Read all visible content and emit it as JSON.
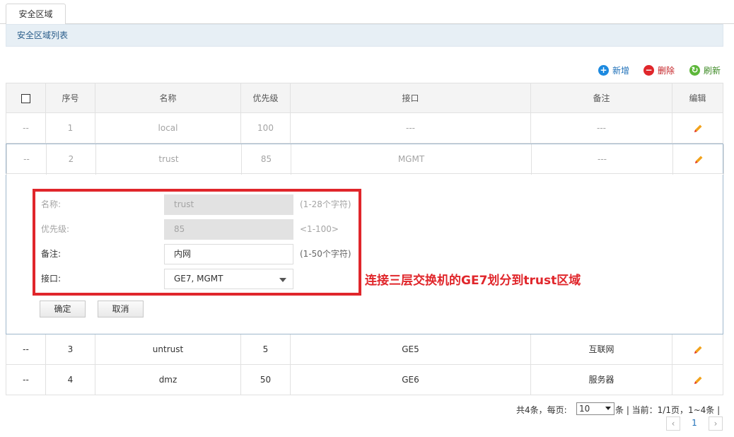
{
  "tab": {
    "label": "安全区域"
  },
  "section": {
    "title": "安全区域列表"
  },
  "toolbar": {
    "add_label": "新增",
    "delete_label": "删除",
    "refresh_label": "刷新"
  },
  "colors": {
    "add": "#1d8ae0",
    "delete": "#e0262b",
    "refresh": "#5db73a",
    "annotation": "#e0262b"
  },
  "table": {
    "headers": [
      "序号",
      "名称",
      "优先级",
      "接口",
      "备注",
      "编辑"
    ],
    "rows": [
      {
        "sel": "--",
        "index": "1",
        "name": "local",
        "priority": "100",
        "iface": "---",
        "note": "---"
      },
      {
        "sel": "--",
        "index": "2",
        "name": "trust",
        "priority": "85",
        "iface": "MGMT",
        "note": "---"
      },
      {
        "sel": "--",
        "index": "3",
        "name": "untrust",
        "priority": "5",
        "iface": "GE5",
        "note": "互联网"
      },
      {
        "sel": "--",
        "index": "4",
        "name": "dmz",
        "priority": "50",
        "iface": "GE6",
        "note": "服务器"
      }
    ]
  },
  "form": {
    "name_label": "名称:",
    "name_value": "trust",
    "name_hint": "(1-28个字符)",
    "priority_label": "优先级:",
    "priority_value": "85",
    "priority_hint": "<1-100>",
    "note_label": "备注:",
    "note_value": "内网",
    "note_hint": "(1-50个字符)",
    "iface_label": "接口:",
    "iface_value": "GE7, MGMT",
    "ok_label": "确定",
    "cancel_label": "取消"
  },
  "annotation": "连接三层交换机的GE7划分到trust区域",
  "pager": {
    "total_text": "共4条，每页:",
    "page_size": "10",
    "status_text": "条 | 当前：1/1页，1~4条 |",
    "prev_label": "‹",
    "current_page": "1",
    "next_label": "›"
  }
}
